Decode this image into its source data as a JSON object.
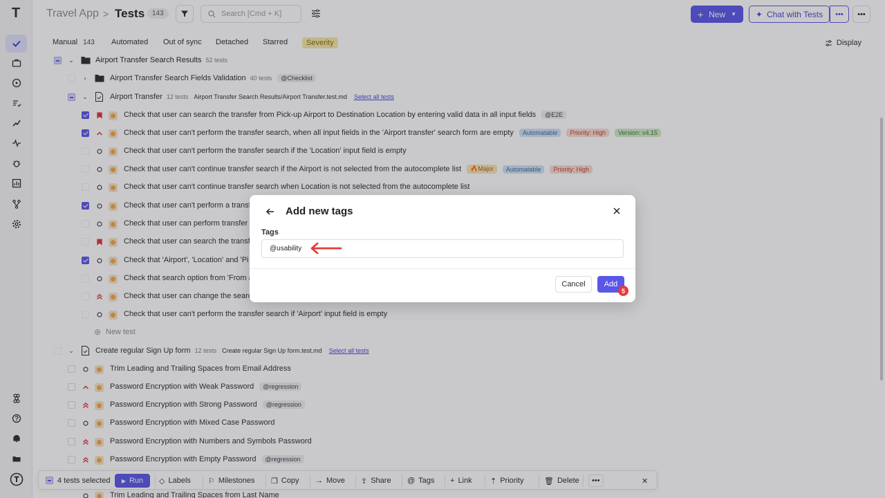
{
  "app": {
    "project": "Travel App",
    "separator": ">",
    "title": "Tests",
    "count": "143",
    "search_placeholder": "Search [Cmd + K]",
    "new_label": "New",
    "chat_label": "Chat with Tests"
  },
  "tabs": {
    "manual": "Manual",
    "manual_count": "143",
    "automated": "Automated",
    "out_of_sync": "Out of sync",
    "detached": "Detached",
    "starred": "Starred",
    "severity": "Severity",
    "display": "Display"
  },
  "suite_results": {
    "name": "Airport Transfer Search Results",
    "meta": "52 tests"
  },
  "suite_fields": {
    "name": "Airport Transfer Search Fields Validation",
    "meta": "40 tests",
    "tag": "@Checklist"
  },
  "suite_transfer": {
    "name": "Airport Transfer",
    "meta": "12 tests",
    "path": "Airport Transfer Search Results/Airport Transfer.test.md",
    "select_all": "Select all tests"
  },
  "tests": [
    {
      "text": "Check that user can search the transfer from Pick-up Airport to Destination Location by entering valid data in all input fields",
      "tag1": "@E2E"
    },
    {
      "text": "Check that user can't perform the transfer search, when all input fields in the 'Airport transfer' search form are empty",
      "tag1": "Automatable",
      "tag2": "Priority: High",
      "tag3": "Version: v4.15"
    },
    {
      "text": "Check that user can't perform the transfer search if the 'Location' input field is empty"
    },
    {
      "text": "Check that user can't continue transfer search if the Airport is not selected from the autocomplete list",
      "tag1": "🔥Major",
      "tag2": "Automatable",
      "tag3": "Priority: High"
    },
    {
      "text": "Check that user can't continue transfer search when Location is not selected from the autocomplete list"
    },
    {
      "text": "Check that user can't perform a transfe"
    },
    {
      "text": "Check that user can perform transfer"
    },
    {
      "text": "Check that user can search the transf"
    },
    {
      "text": "Check that 'Airport', 'Location' and 'Pi"
    },
    {
      "text": "Check that search option from 'From a"
    },
    {
      "text": "Check that user can change the searc"
    },
    {
      "text": "Check that user can't perform the transfer search if 'Airport' input field is empty"
    }
  ],
  "new_test": "New test",
  "suite_signup": {
    "name": "Create regular Sign Up form",
    "meta": "12 tests",
    "path": "Create regular Sign Up form.test.md",
    "select_all": "Select all tests"
  },
  "signup_tests": [
    {
      "text": "Trim Leading and Trailing Spaces from Email Address"
    },
    {
      "text": "Password Encryption with Weak Password",
      "tag1": "@regression"
    },
    {
      "text": "Password Encryption with Strong Password",
      "tag1": "@regression"
    },
    {
      "text": "Password Encryption with Mixed Case Password"
    },
    {
      "text": "Password Encryption with Numbers and Symbols Password"
    },
    {
      "text": "Password Encryption with Empty Password",
      "tag1": "@regression"
    },
    {
      "text": "Trim Leading and Trailing Spaces from Last Name"
    }
  ],
  "modal": {
    "title": "Add new tags",
    "field_label": "Tags",
    "field_value": "@usability",
    "cancel": "Cancel",
    "add": "Add",
    "step": "5"
  },
  "bulk": {
    "selected": "4 tests selected",
    "run": "Run",
    "labels": "Labels",
    "milestones": "Milestones",
    "copy": "Copy",
    "move": "Move",
    "share": "Share",
    "tags": "Tags",
    "link": "Link",
    "priority": "Priority",
    "delete": "Delete"
  },
  "colors": {
    "accent": "#5a56e8",
    "annotation_arrow": "#e53b3b",
    "severity_tab": "#f6e7a6"
  }
}
